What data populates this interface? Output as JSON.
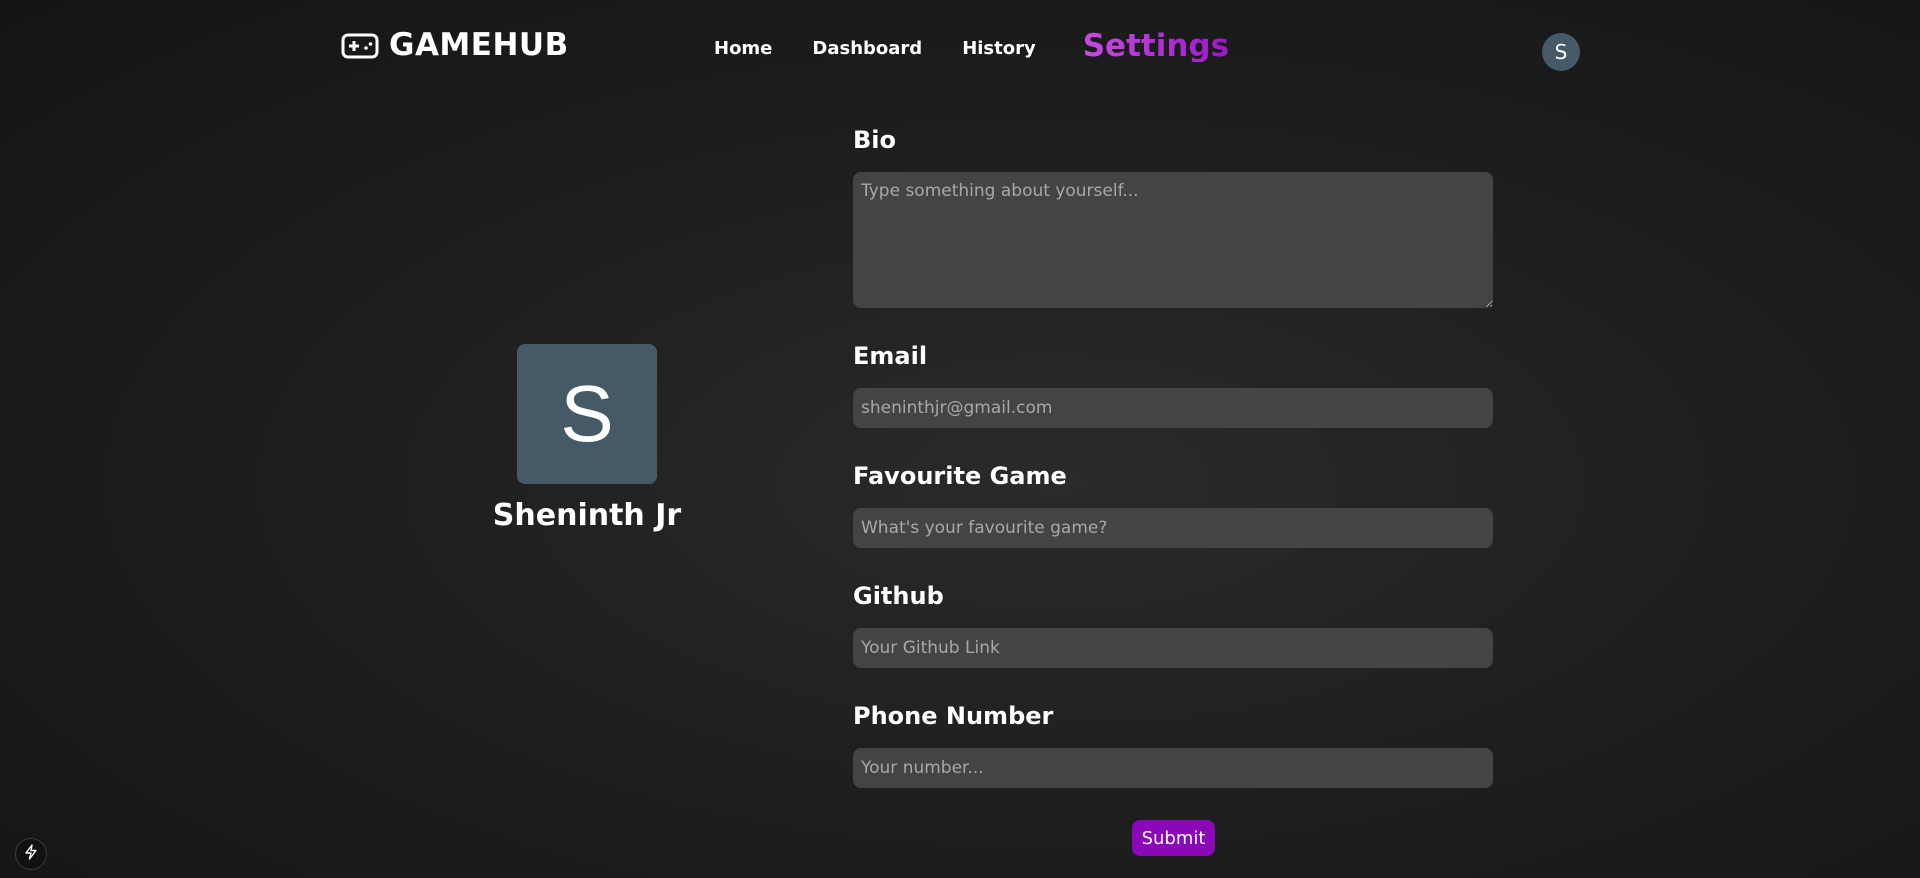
{
  "header": {
    "brand": "GAMEHUB",
    "brand_icon": "gamepad-icon",
    "nav": {
      "home": "Home",
      "dashboard": "Dashboard",
      "history": "History",
      "settings": "Settings"
    },
    "avatar_initial": "S",
    "active_tab": "Settings",
    "accent_color": "#b431d6"
  },
  "profile": {
    "avatar_initial": "S",
    "name": "Sheninth Jr",
    "avatar_color": "#455a66"
  },
  "form": {
    "bio": {
      "label": "Bio",
      "placeholder": "Type something about yourself..."
    },
    "email": {
      "label": "Email",
      "placeholder": "sheninthjr@gmail.com"
    },
    "favourite_game": {
      "label": "Favourite Game",
      "placeholder": "What's your favourite game?"
    },
    "github": {
      "label": "Github",
      "placeholder": "Your Github Link"
    },
    "phone": {
      "label": "Phone Number",
      "placeholder": "Your number..."
    },
    "submit_label": "Submit",
    "submit_color": "#8a08b8"
  },
  "corner_button_icon": "lightning-icon"
}
